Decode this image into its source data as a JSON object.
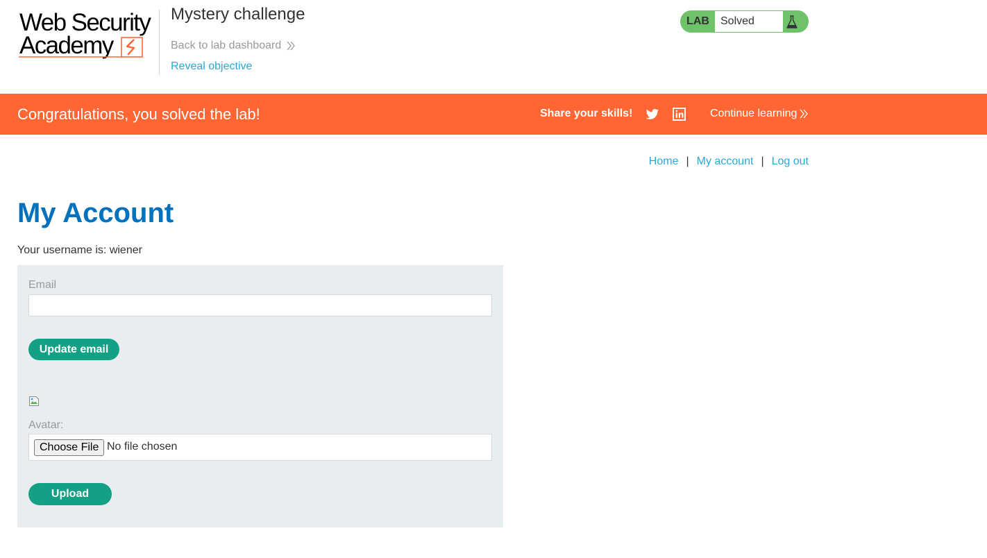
{
  "header": {
    "logo": {
      "line1": "Web Security",
      "line2": "Academy"
    },
    "lab_title": "Mystery challenge",
    "back_link": "Back to lab dashboard",
    "reveal_link": "Reveal objective",
    "status": {
      "label": "LAB",
      "value": "Solved",
      "color": "#6ec36a"
    }
  },
  "banner": {
    "message": "Congratulations, you solved the lab!",
    "share_label": "Share your skills!",
    "icons": [
      "twitter-icon",
      "linkedin-icon"
    ],
    "continue_link": "Continue learning",
    "color": "#ff6633"
  },
  "nav": {
    "home": "Home",
    "separator": "|",
    "my_account": "My account",
    "log_out": "Log out"
  },
  "main": {
    "heading": "My Account",
    "username_line": "Your username is: wiener",
    "email": {
      "label": "Email",
      "value": ""
    },
    "update_button": "Update email",
    "avatar": {
      "label": "Avatar:",
      "choose_button": "Choose File",
      "file_status": "No file chosen"
    },
    "upload_button": "Upload",
    "accent_color": "#14a085",
    "heading_color": "#0071bc"
  }
}
